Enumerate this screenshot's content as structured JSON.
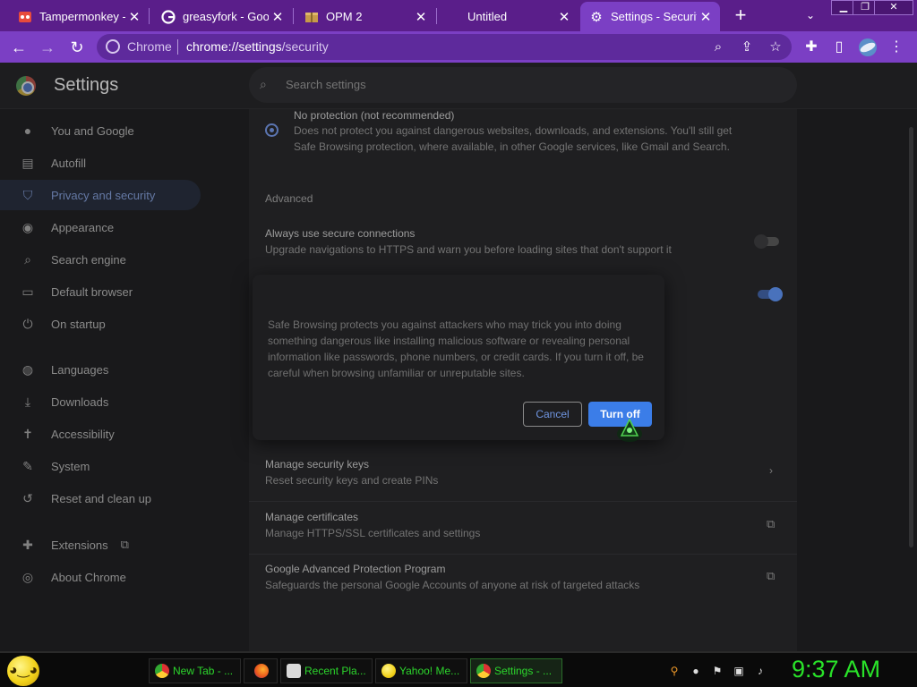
{
  "browser": {
    "tabs": [
      {
        "title": "Tampermonkey - (",
        "icon": "tampermonkey-icon"
      },
      {
        "title": "greasyfork - Goog",
        "icon": "google-icon"
      },
      {
        "title": "OPM 2",
        "icon": "package-icon"
      },
      {
        "title": "Untitled",
        "icon": ""
      },
      {
        "title": "Settings - Security",
        "icon": "gear-icon"
      }
    ],
    "omnibox": {
      "scheme_label": "Chrome",
      "url_host": "chrome://settings",
      "url_path": "/security"
    }
  },
  "settings": {
    "title": "Settings",
    "search_placeholder": "Search settings",
    "nav": [
      {
        "label": "You and Google",
        "icon": "person-icon"
      },
      {
        "label": "Autofill",
        "icon": "clipboard-icon"
      },
      {
        "label": "Privacy and security",
        "icon": "shield-icon",
        "active": true
      },
      {
        "label": "Appearance",
        "icon": "palette-icon"
      },
      {
        "label": "Search engine",
        "icon": "search-icon"
      },
      {
        "label": "Default browser",
        "icon": "browser-icon"
      },
      {
        "label": "On startup",
        "icon": "power-icon"
      },
      {
        "label": "Languages",
        "icon": "globe-icon"
      },
      {
        "label": "Downloads",
        "icon": "download-icon"
      },
      {
        "label": "Accessibility",
        "icon": "accessibility-icon"
      },
      {
        "label": "System",
        "icon": "wrench-icon"
      },
      {
        "label": "Reset and clean up",
        "icon": "history-icon"
      },
      {
        "label": "Extensions",
        "icon": "puzzle-icon"
      },
      {
        "label": "About Chrome",
        "icon": "chrome-icon"
      }
    ],
    "main": {
      "no_protection_title": "No protection (not recommended)",
      "no_protection_desc": "Does not protect you against dangerous websites, downloads, and extensions. You'll still get Safe Browsing protection, where available, in other Google services, like Gmail and Search.",
      "advanced_heading": "Advanced",
      "secure_conn_title": "Always use secure connections",
      "secure_conn_desc": "Upgrade navigations to HTTPS and warn you before loading sites that don't support it",
      "security_keys_title": "Manage security keys",
      "security_keys_desc": "Reset security keys and create PINs",
      "certificates_title": "Manage certificates",
      "certificates_desc": "Manage HTTPS/SSL certificates and settings",
      "gapp_title": "Google Advanced Protection Program",
      "gapp_desc": "Safeguards the personal Google Accounts of anyone at risk of targeted attacks"
    },
    "dialog": {
      "body": "Safe Browsing protects you against attackers who may trick you into doing something dangerous like installing malicious software or revealing personal information like passwords, phone numbers, or credit cards. If you turn it off, be careful when browsing unfamiliar or unreputable sites.",
      "cancel_label": "Cancel",
      "confirm_label": "Turn off"
    }
  },
  "taskbar": {
    "items": [
      {
        "label": "New Tab - ...",
        "icon": "chrome-icon"
      },
      {
        "label": "",
        "icon": "firefox-icon"
      },
      {
        "label": "Recent Pla...",
        "icon": "media-icon"
      },
      {
        "label": "Yahoo! Me...",
        "icon": "yahoo-messenger-icon"
      },
      {
        "label": "Settings - ...",
        "icon": "chrome-icon"
      }
    ],
    "clock": "9:37 AM"
  },
  "colors": {
    "tabstrip": "#5a1e8a",
    "toolbar": "#7b3fc4",
    "accent": "#3b7de8",
    "clock": "#29e229"
  }
}
